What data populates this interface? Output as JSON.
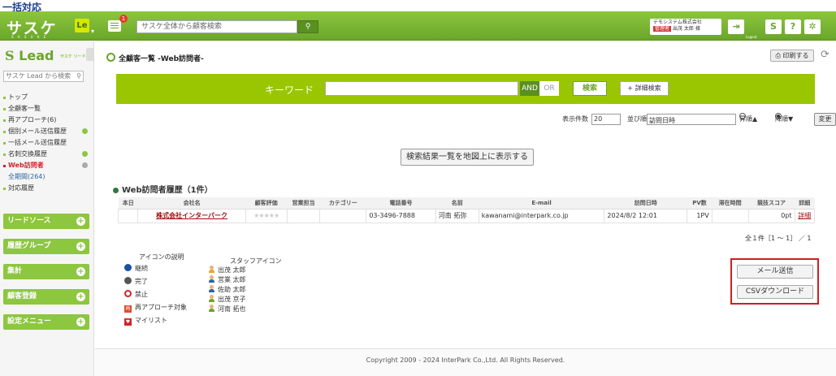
{
  "caption": "一括対応",
  "header": {
    "logo": "サスケ",
    "logo_sub": "S A S U K E",
    "le_badge": "Le",
    "notification_count": "1",
    "search_placeholder": "サスケ全体から顧客検索",
    "company_name": "デモシステム株式会社",
    "user_tag": "管理者",
    "user_name": "出茂 太郎 様",
    "logout_label": "Logout"
  },
  "sidebar": {
    "logo": "Lead",
    "logo_sub": "サスケ リード",
    "search_placeholder": "サスケ Lead から検索",
    "items": [
      {
        "label": "トップ"
      },
      {
        "label": "全顧客一覧"
      },
      {
        "label": "再アプローチ(6)"
      },
      {
        "label": "個別メール送信履歴"
      },
      {
        "label": "一括メール送信履歴"
      },
      {
        "label": "名刺交換履歴"
      },
      {
        "label": "Web訪問者"
      },
      {
        "label": "全期間(264)"
      },
      {
        "label": "対応履歴"
      }
    ],
    "sections": [
      "リードソース",
      "履歴グループ",
      "集計",
      "顧客登録",
      "設定メニュー"
    ]
  },
  "main": {
    "title": "全顧客一覧 -Web訪問者-",
    "print_label": "印刷する",
    "keyword_label": "キーワード",
    "and_label": "AND",
    "or_label": "OR",
    "search_label": "検索",
    "detail_search_label": "+ 詳細検索",
    "display_count_label": "表示件数",
    "display_count_value": "20",
    "sort_label": "並び順",
    "sort_value": "訪問日時",
    "asc_label": "昇順▲",
    "desc_label": "降順▼",
    "change_label": "変更",
    "map_button": "検索結果一覧を地図上に表示する",
    "history_title": "Web訪問者履歴（1件）",
    "columns": [
      "本日",
      "会社名",
      "顧客評価",
      "営業担当",
      "カテゴリー",
      "電話番号",
      "名前",
      "E-mail",
      "訪問日時",
      "PV数",
      "滞在時間",
      "競技スコア",
      "詳細"
    ],
    "rows": [
      {
        "today": "",
        "company": "株式会社インターパーク",
        "rating": "★★★★★",
        "sales": "",
        "category": "",
        "phone": "03-3496-7888",
        "name": "河南 拓弥",
        "email": "kawanami@interpark.co.jp",
        "visited": "2024/8/2 12:01",
        "pv": "1PV",
        "stay": "",
        "score": "0pt",
        "detail": "詳細"
      }
    ],
    "count_line": "全１件［1 ～ 1］ ／ 1",
    "legend_title": "アイコンの説明",
    "legend_items": [
      "継続",
      "完了",
      "禁止",
      "再アプローチ対象",
      "マイリスト"
    ],
    "staff_title": "スタッフアイコン",
    "staff_items": [
      "出茂 太郎",
      "営業 太郎",
      "佐助 太郎",
      "出茂 京子",
      "河南 拓也"
    ],
    "mail_button": "メール送信",
    "csv_button": "CSVダウンロード",
    "footer": "Copyright 2009 - 2024 InterPark Co.,Ltd. All Rights Reserved."
  }
}
